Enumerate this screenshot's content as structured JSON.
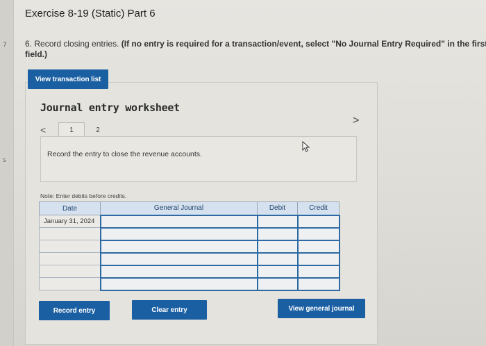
{
  "title": "Exercise 8-19 (Static) Part 6",
  "instruction": {
    "number": "6.",
    "text": " Record closing entries. ",
    "bold": "(If no entry is required for a transaction/event, select \"No Journal Entry Required\" in the first ac",
    "bold_line2": "field.)"
  },
  "left_marks": [
    "7",
    "s"
  ],
  "view_transaction_list": "View transaction list",
  "worksheet": {
    "title": "Journal entry worksheet",
    "tabs": [
      "1",
      "2"
    ],
    "prev": "<",
    "next": ">",
    "entry_text": "Record the entry to close the revenue accounts.",
    "note": "Note: Enter debits before credits."
  },
  "table": {
    "headers": [
      "Date",
      "General Journal",
      "Debit",
      "Credit"
    ],
    "rows": [
      [
        "January 31, 2024",
        "",
        "",
        ""
      ],
      [
        "",
        "",
        "",
        ""
      ],
      [
        "",
        "",
        "",
        ""
      ],
      [
        "",
        "",
        "",
        ""
      ],
      [
        "",
        "",
        "",
        ""
      ],
      [
        "",
        "",
        "",
        ""
      ]
    ]
  },
  "buttons": {
    "record_entry": "Record entry",
    "clear_entry": "Clear entry",
    "view_general_journal": "View general journal"
  },
  "colors": {
    "button": "#1b5fa3",
    "header": "#d5e1ee",
    "field_border": "#2d6aa3"
  }
}
